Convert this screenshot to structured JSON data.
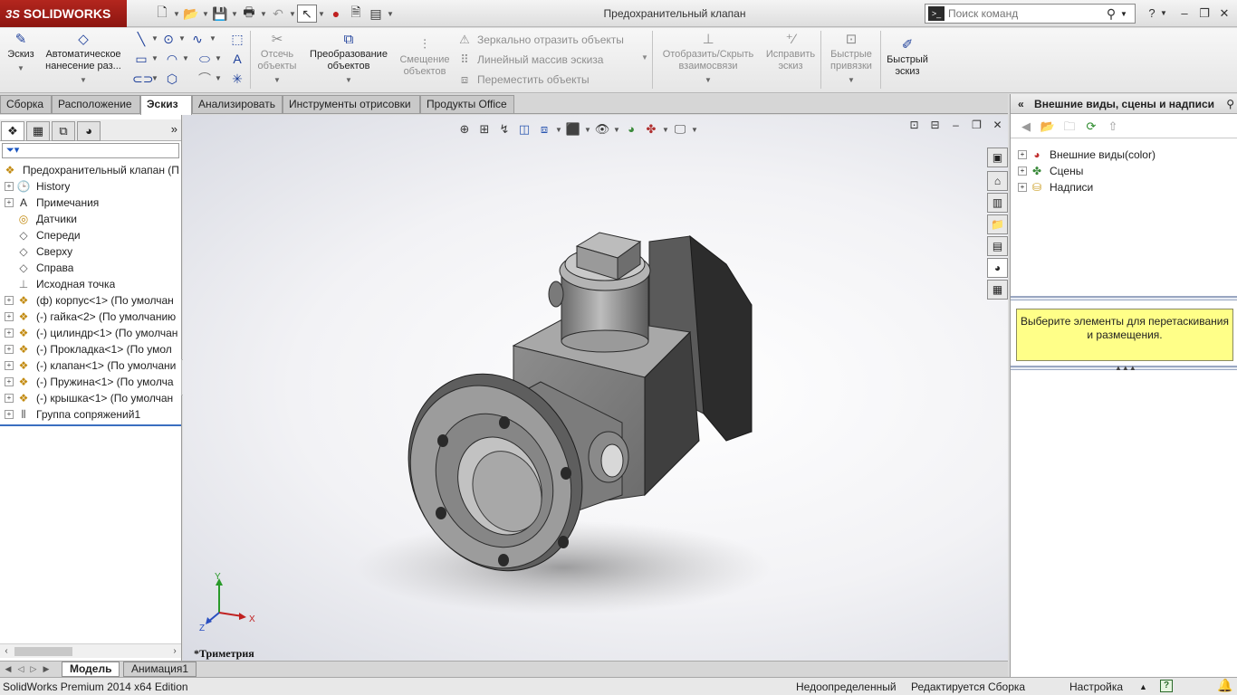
{
  "app": {
    "logo_text": "SOLIDWORKS",
    "logo_prefix": "3S",
    "document_title": "Предохранительный клапан"
  },
  "search": {
    "placeholder": "Поиск команд"
  },
  "ribbon": {
    "sketch": "Эскиз",
    "auto_dimension": "Автоматическое нанесение раз...",
    "trim": "Отсечь объекты",
    "convert": "Преобразование объектов",
    "offset": "Смещение объектов",
    "mirror": "Зеркально отразить объекты",
    "linear_pattern": "Линейный массив эскиза",
    "move": "Переместить объекты",
    "display_relations": "Отобразить/Скрыть взаимосвязи",
    "repair": "Исправить эскиз",
    "quick_snaps": "Быстрые привязки",
    "rapid_sketch": "Быстрый эскиз"
  },
  "command_tabs": [
    "Сборка",
    "Расположение",
    "Эскиз",
    "Анализировать",
    "Инструменты отрисовки",
    "Продукты Office"
  ],
  "command_tab_active": 2,
  "feature_tree": {
    "root": "Предохранительный клапан  (П",
    "items": [
      {
        "label": "History",
        "icon": "history-icon",
        "expandable": true
      },
      {
        "label": "Примечания",
        "icon": "annotations-icon",
        "expandable": true
      },
      {
        "label": "Датчики",
        "icon": "sensors-icon",
        "expandable": false
      },
      {
        "label": "Спереди",
        "icon": "plane-icon",
        "expandable": false
      },
      {
        "label": "Сверху",
        "icon": "plane-icon",
        "expandable": false
      },
      {
        "label": "Справа",
        "icon": "plane-icon",
        "expandable": false
      },
      {
        "label": "Исходная точка",
        "icon": "origin-icon",
        "expandable": false
      },
      {
        "label": "(ф) корпус<1> (По умолчан",
        "icon": "part-icon",
        "expandable": true
      },
      {
        "label": "(-) гайка<2> (По умолчанию",
        "icon": "part-icon",
        "expandable": true
      },
      {
        "label": "(-) цилиндр<1> (По умолчан",
        "icon": "part-icon",
        "expandable": true
      },
      {
        "label": "(-) Прокладка<1> (По умол",
        "icon": "part-icon",
        "expandable": true
      },
      {
        "label": "(-) клапан<1> (По умолчани",
        "icon": "part-icon",
        "expandable": true
      },
      {
        "label": "(-) Пружина<1> (По умолча",
        "icon": "part-icon",
        "expandable": true
      },
      {
        "label": "(-) крышка<1> (По умолчан",
        "icon": "part-icon",
        "expandable": true
      },
      {
        "label": "Группа сопряжений1",
        "icon": "mates-icon",
        "expandable": true
      }
    ]
  },
  "model_tabs": [
    "Модель",
    "Анимация1"
  ],
  "viewport": {
    "view_name": "*Триметрия",
    "triad": {
      "x": "X",
      "y": "Y",
      "z": "Z"
    }
  },
  "task_pane": {
    "title": "Внешние виды, сцены и надписи",
    "items": [
      "Внешние виды(color)",
      "Сцены",
      "Надписи"
    ],
    "hint": "Выберите элементы для перетаскивания и размещения."
  },
  "status_bar": {
    "edition": "SolidWorks Premium 2014 x64 Edition",
    "state": "Недоопределенный",
    "editing": "Редактируется Сборка",
    "customize": "Настройка"
  },
  "colors": {
    "logo_red": "#a81f18",
    "hint_yellow": "#ffff88",
    "part_gray": "#7a7a7a"
  }
}
